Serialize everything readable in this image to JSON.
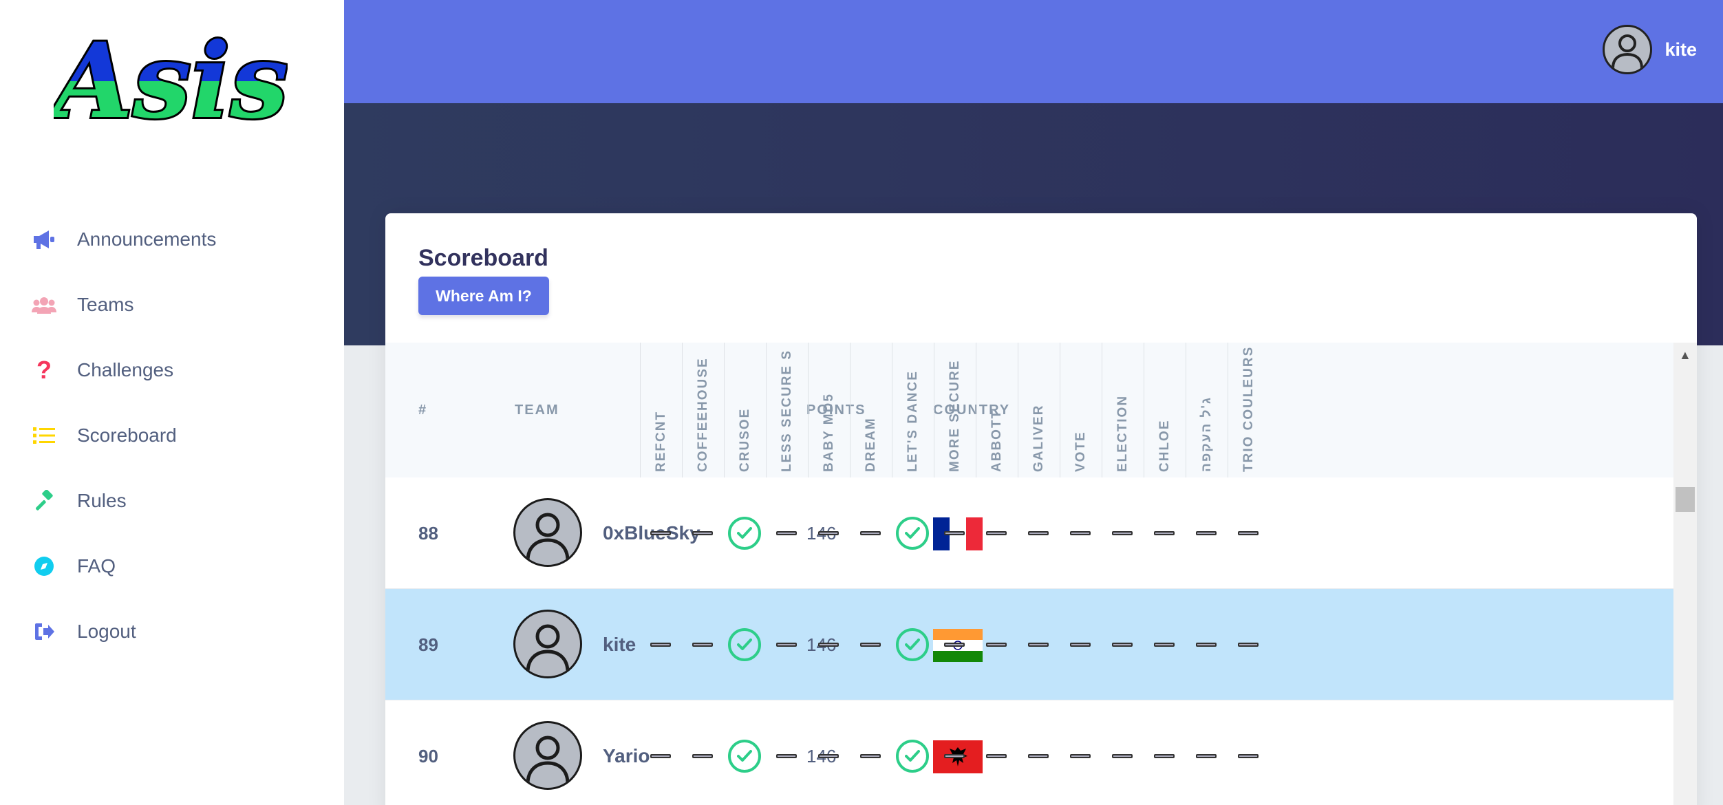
{
  "brand": {
    "logo_text": "Asis"
  },
  "sidebar": {
    "items": [
      {
        "label": "Announcements",
        "icon": "megaphone-icon",
        "color": "#5e72e4"
      },
      {
        "label": "Teams",
        "icon": "users-icon",
        "color": "#f3a4b5"
      },
      {
        "label": "Challenges",
        "icon": "question-icon",
        "color": "#f5365c"
      },
      {
        "label": "Scoreboard",
        "icon": "list-icon",
        "color": "#ffd600"
      },
      {
        "label": "Rules",
        "icon": "gavel-icon",
        "color": "#2dce89"
      },
      {
        "label": "FAQ",
        "icon": "compass-icon",
        "color": "#11cdef"
      },
      {
        "label": "Logout",
        "icon": "logout-icon",
        "color": "#5e72e4"
      }
    ]
  },
  "header": {
    "username": "kite"
  },
  "scoreboard": {
    "title": "Scoreboard",
    "where_button": "Where Am I?",
    "columns": {
      "rank": "#",
      "team": "TEAM",
      "points": "POINTS",
      "country": "COUNTRY"
    },
    "challenges": [
      "REFCNT",
      "COFFEEHOUSE",
      "CRUSOE",
      "LESS SECURE S",
      "BABY MD5",
      "DREAM",
      "LET'S DANCE",
      "MORE SECURE",
      "ABBOTT",
      "GALIVER",
      "VOTE",
      "ELECTION",
      "CHLOE",
      "ג'ל העקפה",
      "TRIO COULEURS"
    ],
    "rows": [
      {
        "rank": "88",
        "team": "0xBlueSky",
        "points": "146",
        "country": "france",
        "solved": [
          2,
          6
        ],
        "highlight": false
      },
      {
        "rank": "89",
        "team": "kite",
        "points": "146",
        "country": "india",
        "solved": [
          2,
          6
        ],
        "highlight": true
      },
      {
        "rank": "90",
        "team": "Yario",
        "points": "146",
        "country": "albania",
        "solved": [
          2,
          6
        ],
        "highlight": false
      }
    ]
  },
  "colors": {
    "primary": "#5e72e4",
    "success": "#2dce89",
    "highlight_row": "#c1e4fb"
  }
}
